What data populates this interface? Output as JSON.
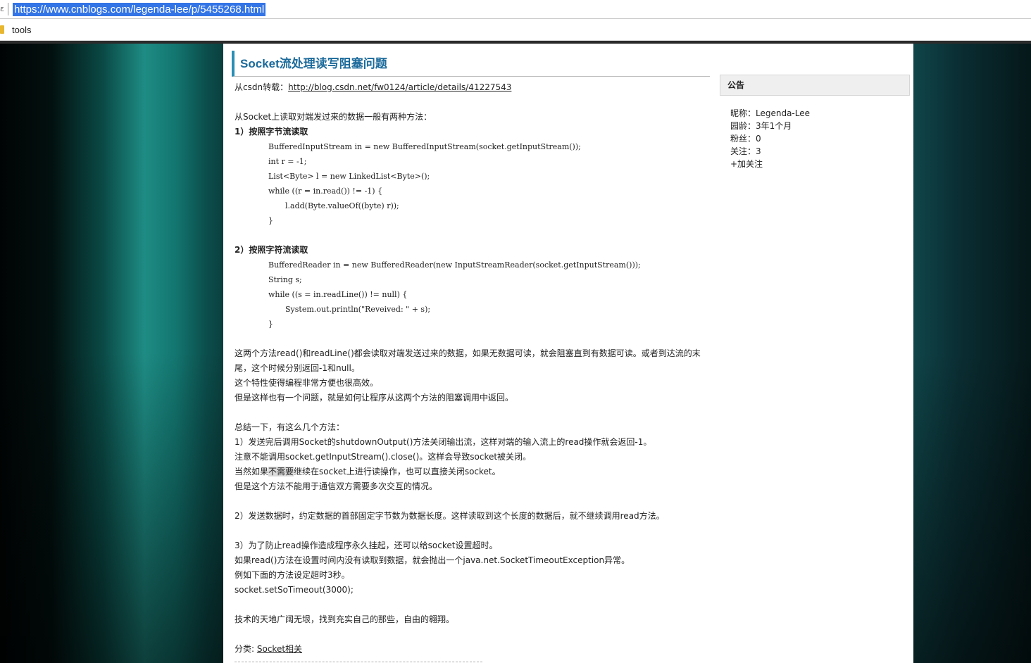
{
  "browser": {
    "url": "https://www.cnblogs.com/legenda-lee/p/5455268.html",
    "bookmark": "tools"
  },
  "post": {
    "title": "Socket流处理读写阻塞问题",
    "source_prefix": "从csdn转载：",
    "source_link": "http://blog.csdn.net/fw0124/article/details/41227543",
    "intro": "从Socket上读取对端发过来的数据一般有两种方法：",
    "method1_title": "1）按照字节流读取",
    "code1": [
      "BufferedInputStream in = new BufferedInputStream(socket.getInputStream());",
      "int r = -1;",
      "List<Byte> l = new LinkedList<Byte>();",
      "while ((r = in.read()) != -1) {",
      "l.add(Byte.valueOf((byte) r));",
      "}"
    ],
    "method2_title": "2）按照字符流读取",
    "code2": [
      "BufferedReader in = new BufferedReader(new InputStreamReader(socket.getInputStream()));",
      "String s;",
      "while ((s = in.readLine()) != null) {",
      "System.out.println(\"Reveived: \" + s);",
      "}"
    ],
    "para1": [
      "这两个方法read()和readLine()都会读取对端发送过来的数据，如果无数据可读，就会阻塞直到有数据可读。或者到达流的末",
      "尾，这个时候分别返回-1和null。",
      "这个特性使得编程非常方便也很高效。",
      "但是这样也有一个问题，就是如何让程序从这两个方法的阻塞调用中返回。"
    ],
    "summary_intro": "总结一下，有这么几个方法：",
    "sol1": [
      "1）发送完后调用Socket的shutdownOutput()方法关闭输出流，这样对端的输入流上的read操作就会返回-1。",
      "注意不能调用socket.getInputStream().close()。这样会导致socket被关闭。"
    ],
    "sol1_line3_a": "当然如果",
    "sol1_line3_hl": "不需要",
    "sol1_line3_b": "继续在socket上进行读操作，也可以直接关闭socket。",
    "sol1_line4": "但是这个方法不能用于通信双方需要多次交互的情况。",
    "sol2": "2）发送数据时，约定数据的首部固定字节数为数据长度。这样读取到这个长度的数据后，就不继续调用read方法。",
    "sol3": [
      "3）为了防止read操作造成程序永久挂起，还可以给socket设置超时。",
      "如果read()方法在设置时间内没有读取到数据，就会抛出一个java.net.SocketTimeoutException异常。",
      "例如下面的方法设定超时3秒。",
      "socket.setSoTimeout(3000);"
    ],
    "closing": "技术的天地广阔无垠，找到充实自己的那些，自由的翱翔。",
    "category_label": "分类: ",
    "category_link": "Socket相关"
  },
  "sidebar": {
    "notice_title": "公告",
    "nickname": "昵称：Legenda-Lee",
    "age": "园龄：3年1个月",
    "fans": "粉丝：0",
    "follow": "关注：3",
    "add_follow": "+加关注"
  }
}
